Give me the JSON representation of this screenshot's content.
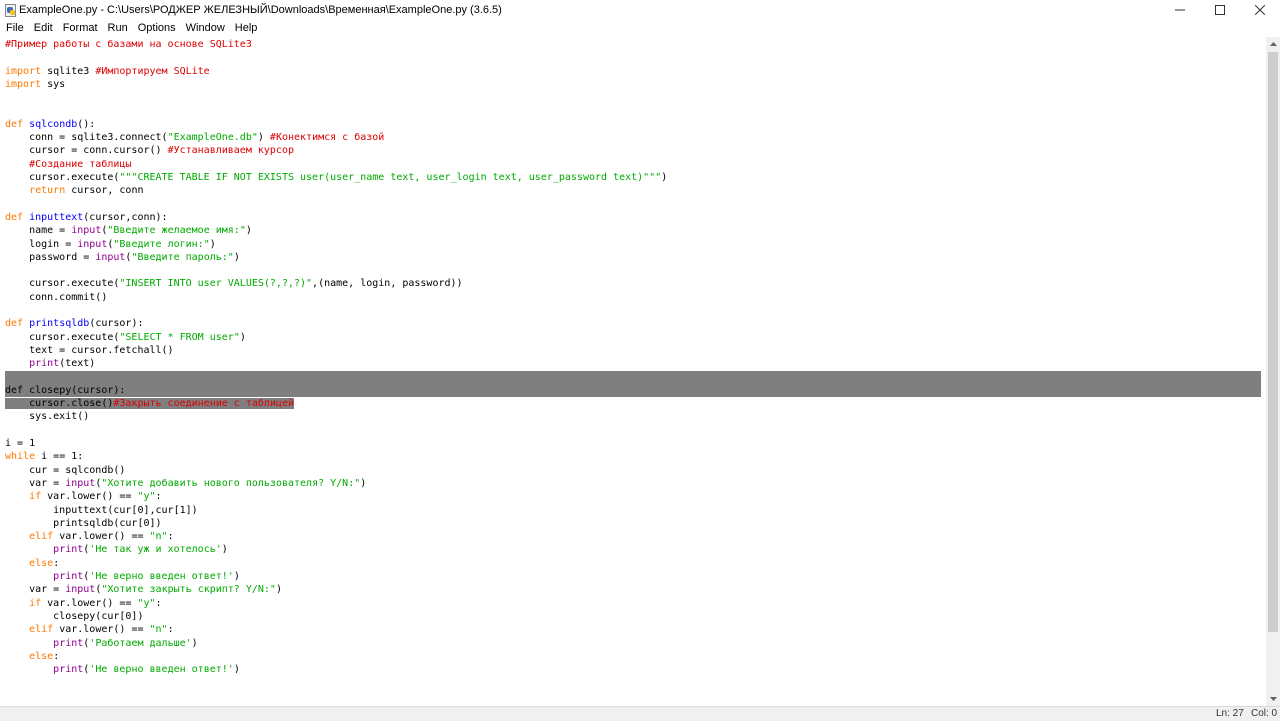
{
  "window": {
    "title": "ExampleOne.py - C:\\Users\\РОДЖЕР ЖЕЛЕЗНЫЙ\\Downloads\\Временная\\ExampleOne.py (3.6.5)",
    "minimize_icon": "minimize-icon",
    "maximize_icon": "maximize-icon",
    "close_icon": "close-icon"
  },
  "menu": [
    "File",
    "Edit",
    "Format",
    "Run",
    "Options",
    "Window",
    "Help"
  ],
  "colors": {
    "comment": "#dd0000",
    "keyword": "#ff7700",
    "builtin": "#900090",
    "string": "#00aa00",
    "defname": "#0000ff",
    "default": "#000000",
    "selection": "#7f7f7f"
  },
  "code": {
    "selected_lines": [
      26,
      27
    ],
    "partial_selected_line": 28,
    "lines": [
      [
        [
          "comment",
          "#Пример работы с базами на основе SQLite3"
        ]
      ],
      [],
      [
        [
          "keyword",
          "import"
        ],
        [
          "default",
          " sqlite3 "
        ],
        [
          "comment",
          "#Импортируем SQLite"
        ]
      ],
      [
        [
          "keyword",
          "import"
        ],
        [
          "default",
          " sys"
        ]
      ],
      [],
      [],
      [
        [
          "keyword",
          "def"
        ],
        [
          "default",
          " "
        ],
        [
          "defname",
          "sqlcondb"
        ],
        [
          "default",
          "():"
        ]
      ],
      [
        [
          "default",
          "    conn = sqlite3.connect("
        ],
        [
          "string",
          "\"ExampleOne.db\""
        ],
        [
          "default",
          ") "
        ],
        [
          "comment",
          "#Конектимся с базой"
        ]
      ],
      [
        [
          "default",
          "    cursor = conn.cursor() "
        ],
        [
          "comment",
          "#Устанавливаем курсор"
        ]
      ],
      [
        [
          "comment",
          "    #Создание таблицы"
        ]
      ],
      [
        [
          "default",
          "    cursor.execute("
        ],
        [
          "string",
          "\"\"\"CREATE TABLE IF NOT EXISTS user(user_name text, user_login text, user_password text)\"\"\""
        ],
        [
          "default",
          ")"
        ]
      ],
      [
        [
          "default",
          "    "
        ],
        [
          "keyword",
          "return"
        ],
        [
          "default",
          " cursor, conn"
        ]
      ],
      [],
      [
        [
          "keyword",
          "def"
        ],
        [
          "default",
          " "
        ],
        [
          "defname",
          "inputtext"
        ],
        [
          "default",
          "(cursor,conn):"
        ]
      ],
      [
        [
          "default",
          "    name = "
        ],
        [
          "builtin",
          "input"
        ],
        [
          "default",
          "("
        ],
        [
          "string",
          "\"Введите желаемое имя:\""
        ],
        [
          "default",
          ")"
        ]
      ],
      [
        [
          "default",
          "    login = "
        ],
        [
          "builtin",
          "input"
        ],
        [
          "default",
          "("
        ],
        [
          "string",
          "\"Введите логин:\""
        ],
        [
          "default",
          ")"
        ]
      ],
      [
        [
          "default",
          "    password = "
        ],
        [
          "builtin",
          "input"
        ],
        [
          "default",
          "("
        ],
        [
          "string",
          "\"Введите пароль:\""
        ],
        [
          "default",
          ")"
        ]
      ],
      [],
      [
        [
          "default",
          "    cursor.execute("
        ],
        [
          "string",
          "\"INSERT INTO user VALUES(?,?,?)\""
        ],
        [
          "default",
          ",(name, login, password))"
        ]
      ],
      [
        [
          "default",
          "    conn.commit()"
        ]
      ],
      [],
      [
        [
          "keyword",
          "def"
        ],
        [
          "default",
          " "
        ],
        [
          "defname",
          "printsqldb"
        ],
        [
          "default",
          "(cursor):"
        ]
      ],
      [
        [
          "default",
          "    cursor.execute("
        ],
        [
          "string",
          "\"SELECT * FROM user\""
        ],
        [
          "default",
          ")"
        ]
      ],
      [
        [
          "default",
          "    text = cursor.fetchall()"
        ]
      ],
      [
        [
          "default",
          "    "
        ],
        [
          "builtin",
          "print"
        ],
        [
          "default",
          "(text)"
        ]
      ],
      [],
      [
        [
          "keyword",
          "def"
        ],
        [
          "default",
          " "
        ],
        [
          "defname",
          "closepy"
        ],
        [
          "default",
          "(cursor):"
        ]
      ],
      [
        [
          "default",
          "    cursor.close()"
        ],
        [
          "comment",
          "#Закрыть соединение с таблицей"
        ]
      ],
      [
        [
          "default",
          "    sys.exit()"
        ]
      ],
      [],
      [
        [
          "default",
          "i = 1"
        ]
      ],
      [
        [
          "keyword",
          "while"
        ],
        [
          "default",
          " i == 1:"
        ]
      ],
      [
        [
          "default",
          "    cur = sqlcondb()"
        ]
      ],
      [
        [
          "default",
          "    var = "
        ],
        [
          "builtin",
          "input"
        ],
        [
          "default",
          "("
        ],
        [
          "string",
          "\"Хотите добавить нового пользователя? Y/N:\""
        ],
        [
          "default",
          ")"
        ]
      ],
      [
        [
          "default",
          "    "
        ],
        [
          "keyword",
          "if"
        ],
        [
          "default",
          " var.lower() == "
        ],
        [
          "string",
          "\"y\""
        ],
        [
          "default",
          ":"
        ]
      ],
      [
        [
          "default",
          "        inputtext(cur[0],cur[1])"
        ]
      ],
      [
        [
          "default",
          "        printsqldb(cur[0])"
        ]
      ],
      [
        [
          "default",
          "    "
        ],
        [
          "keyword",
          "elif"
        ],
        [
          "default",
          " var.lower() == "
        ],
        [
          "string",
          "\"n\""
        ],
        [
          "default",
          ":"
        ]
      ],
      [
        [
          "default",
          "        "
        ],
        [
          "builtin",
          "print"
        ],
        [
          "default",
          "("
        ],
        [
          "string",
          "'Не так уж и хотелось'"
        ],
        [
          "default",
          ")"
        ]
      ],
      [
        [
          "default",
          "    "
        ],
        [
          "keyword",
          "else"
        ],
        [
          "default",
          ":"
        ]
      ],
      [
        [
          "default",
          "        "
        ],
        [
          "builtin",
          "print"
        ],
        [
          "default",
          "("
        ],
        [
          "string",
          "'Не верно введен ответ!'"
        ],
        [
          "default",
          ")"
        ]
      ],
      [
        [
          "default",
          "    var = "
        ],
        [
          "builtin",
          "input"
        ],
        [
          "default",
          "("
        ],
        [
          "string",
          "\"Хотите закрыть скрипт? Y/N:\""
        ],
        [
          "default",
          ")"
        ]
      ],
      [
        [
          "default",
          "    "
        ],
        [
          "keyword",
          "if"
        ],
        [
          "default",
          " var.lower() == "
        ],
        [
          "string",
          "\"y\""
        ],
        [
          "default",
          ":"
        ]
      ],
      [
        [
          "default",
          "        closepy(cur[0])"
        ]
      ],
      [
        [
          "default",
          "    "
        ],
        [
          "keyword",
          "elif"
        ],
        [
          "default",
          " var.lower() == "
        ],
        [
          "string",
          "\"n\""
        ],
        [
          "default",
          ":"
        ]
      ],
      [
        [
          "default",
          "        "
        ],
        [
          "builtin",
          "print"
        ],
        [
          "default",
          "("
        ],
        [
          "string",
          "'Работаем дальше'"
        ],
        [
          "default",
          ")"
        ]
      ],
      [
        [
          "default",
          "    "
        ],
        [
          "keyword",
          "else"
        ],
        [
          "default",
          ":"
        ]
      ],
      [
        [
          "default",
          "        "
        ],
        [
          "builtin",
          "print"
        ],
        [
          "default",
          "("
        ],
        [
          "string",
          "'Не верно введен ответ!'"
        ],
        [
          "default",
          ")"
        ]
      ]
    ]
  },
  "status": {
    "line": "Ln: 27",
    "col": "Col: 0"
  }
}
